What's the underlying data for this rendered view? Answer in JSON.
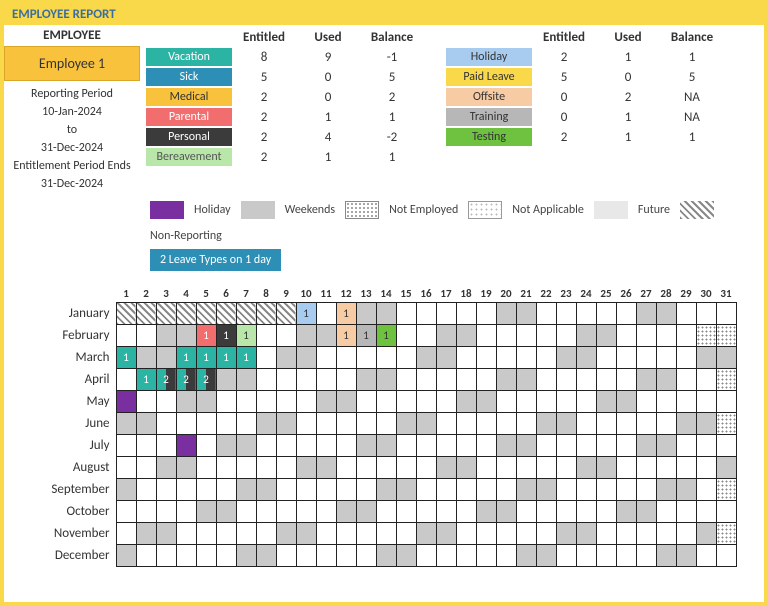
{
  "title": "EMPLOYEE REPORT",
  "meta": {
    "employee_header": "EMPLOYEE",
    "employee_name": "Employee 1",
    "reporting_period_label": "Reporting Period",
    "reporting_from": "10-Jan-2024",
    "to_label": "to",
    "reporting_to": "31-Dec-2024",
    "entitlement_ends_label": "Entitlement Period Ends",
    "entitlement_ends": "31-Dec-2024"
  },
  "columns": {
    "entitled": "Entitled",
    "used": "Used",
    "balance": "Balance"
  },
  "leave_left": [
    {
      "name": "Vacation",
      "color": "c-vacation",
      "entitled": "8",
      "used": "9",
      "balance": "-1"
    },
    {
      "name": "Sick",
      "color": "c-sick",
      "entitled": "5",
      "used": "0",
      "balance": "5"
    },
    {
      "name": "Medical",
      "color": "c-medical",
      "entitled": "2",
      "used": "0",
      "balance": "2"
    },
    {
      "name": "Parental",
      "color": "c-parental",
      "entitled": "2",
      "used": "1",
      "balance": "1"
    },
    {
      "name": "Personal",
      "color": "c-personal",
      "entitled": "2",
      "used": "4",
      "balance": "-2"
    },
    {
      "name": "Bereavement",
      "color": "c-bereave",
      "entitled": "2",
      "used": "1",
      "balance": "1"
    }
  ],
  "leave_right": [
    {
      "name": "Holiday",
      "color": "c-holiday",
      "entitled": "2",
      "used": "1",
      "balance": "1"
    },
    {
      "name": "Paid Leave",
      "color": "c-paidleave",
      "entitled": "5",
      "used": "0",
      "balance": "5"
    },
    {
      "name": "Offsite",
      "color": "c-offsite",
      "entitled": "0",
      "used": "2",
      "balance": "NA"
    },
    {
      "name": "Training",
      "color": "c-training",
      "entitled": "0",
      "used": "1",
      "balance": "NA"
    },
    {
      "name": "Testing",
      "color": "c-testing",
      "entitled": "2",
      "used": "1",
      "balance": "1"
    }
  ],
  "legend2": {
    "holiday": "Holiday",
    "weekends": "Weekends",
    "not_employed": "Not Employed",
    "not_applicable": "Not Applicable",
    "future": "Future",
    "non_reporting": "Non-Reporting",
    "two_leave": "2 Leave Types on 1 day"
  },
  "months": [
    "January",
    "February",
    "March",
    "April",
    "May",
    "June",
    "July",
    "August",
    "September",
    "October",
    "November",
    "December"
  ],
  "days_in_month": [
    31,
    29,
    31,
    30,
    31,
    30,
    31,
    31,
    30,
    31,
    30,
    31
  ],
  "first_dow": [
    1,
    4,
    5,
    1,
    3,
    6,
    1,
    4,
    0,
    2,
    5,
    0
  ],
  "weekend_dows": [
    0,
    6
  ],
  "calendar_marks": {
    "January": {
      "nr": [
        1,
        2,
        3,
        4,
        5,
        6,
        7,
        8,
        9
      ],
      "cells": {
        "10": {
          "bg": "#a8ccf0",
          "v": "1",
          "t": "dark"
        },
        "12": {
          "bg": "#f7cba4",
          "v": "1",
          "t": "dark"
        }
      }
    },
    "February": {
      "cells": {
        "5": {
          "bg": "#f26d6d",
          "v": "1"
        },
        "6": {
          "bg": "#3b3b3b",
          "v": "1"
        },
        "7": {
          "bg": "#b9e6a9",
          "v": "1",
          "t": "dark"
        },
        "12": {
          "bg": "#f7cba4",
          "v": "1",
          "t": "dark"
        },
        "13": {
          "bg": "#b7b7b7",
          "v": "1",
          "t": "dark"
        },
        "14": {
          "bg": "#6ec23f",
          "v": "1",
          "t": "dark"
        }
      }
    },
    "March": {
      "cells": {
        "1": {
          "bg": "#2bb3a3",
          "v": "1"
        },
        "4": {
          "bg": "#2bb3a3",
          "v": "1"
        },
        "5": {
          "bg": "#2bb3a3",
          "v": "1"
        },
        "6": {
          "bg": "#2bb3a3",
          "v": "1"
        },
        "7": {
          "bg": "#2bb3a3",
          "v": "1"
        }
      }
    },
    "April": {
      "cells": {
        "2": {
          "bg": "#2bb3a3",
          "v": "1"
        },
        "3": {
          "bg": "linear-gradient(90deg,#2bb3a3 50%,#3b3b3b 50%)",
          "v": "2"
        },
        "4": {
          "bg": "linear-gradient(90deg,#2bb3a3 50%,#3b3b3b 50%)",
          "v": "2"
        },
        "5": {
          "bg": "linear-gradient(90deg,#2bb3a3 50%,#3b3b3b 50%)",
          "v": "2"
        }
      }
    },
    "May": {
      "cells": {
        "1": {
          "bg": "#7a2fa0"
        }
      }
    },
    "July": {
      "cells": {
        "4": {
          "bg": "#7a2fa0"
        }
      }
    }
  }
}
